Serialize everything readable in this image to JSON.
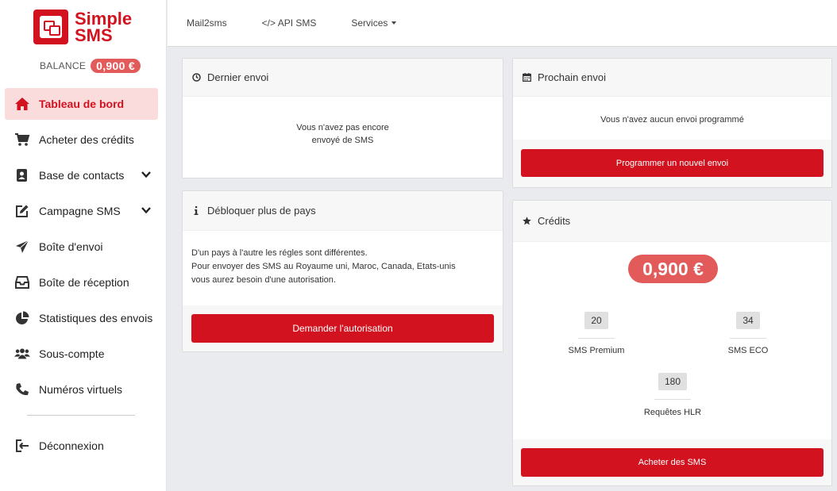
{
  "brand": {
    "line1": "Simple",
    "line2": "SMS"
  },
  "balance": {
    "label": "BALANCE",
    "value": "0,900 €"
  },
  "sidebar": {
    "items": [
      {
        "label": "Tableau de bord"
      },
      {
        "label": "Acheter des crédits"
      },
      {
        "label": "Base de contacts"
      },
      {
        "label": "Campagne SMS"
      },
      {
        "label": "Boîte d'envoi"
      },
      {
        "label": "Boîte de réception"
      },
      {
        "label": "Statistiques des envois"
      },
      {
        "label": "Sous-compte"
      },
      {
        "label": "Numéros virtuels"
      }
    ],
    "logout": "Déconnexion"
  },
  "topnav": {
    "mail2sms": "Mail2sms",
    "api_sms": "</> API SMS",
    "services": "Services"
  },
  "last_send": {
    "title": "Dernier envoi",
    "line1": "Vous n'avez pas encore",
    "line2": "envoyé de SMS"
  },
  "unlock": {
    "title": "Débloquer plus de pays",
    "line1": "D'un pays à l'autre les régles sont différentes.",
    "line2": "Pour envoyer des SMS au Royaume uni, Maroc, Canada, Etats-unis",
    "line3": "vous aurez besoin d'une autorisation.",
    "button": "Demander l'autorisation"
  },
  "next_send": {
    "title": "Prochain envoi",
    "text": "Vous n'avez aucun envoi programmé",
    "button": "Programmer un nouvel envoi"
  },
  "credits": {
    "title": "Crédits",
    "amount": "0,900 €",
    "premium": {
      "value": "20",
      "label": "SMS Premium"
    },
    "eco": {
      "value": "34",
      "label": "SMS ECO"
    },
    "hlr": {
      "value": "180",
      "label": "Requêtes HLR"
    },
    "button": "Acheter des SMS"
  },
  "colors": {
    "accent": "#d3121f",
    "active_bg": "#fadcdc",
    "badge": "#e35a5a"
  }
}
